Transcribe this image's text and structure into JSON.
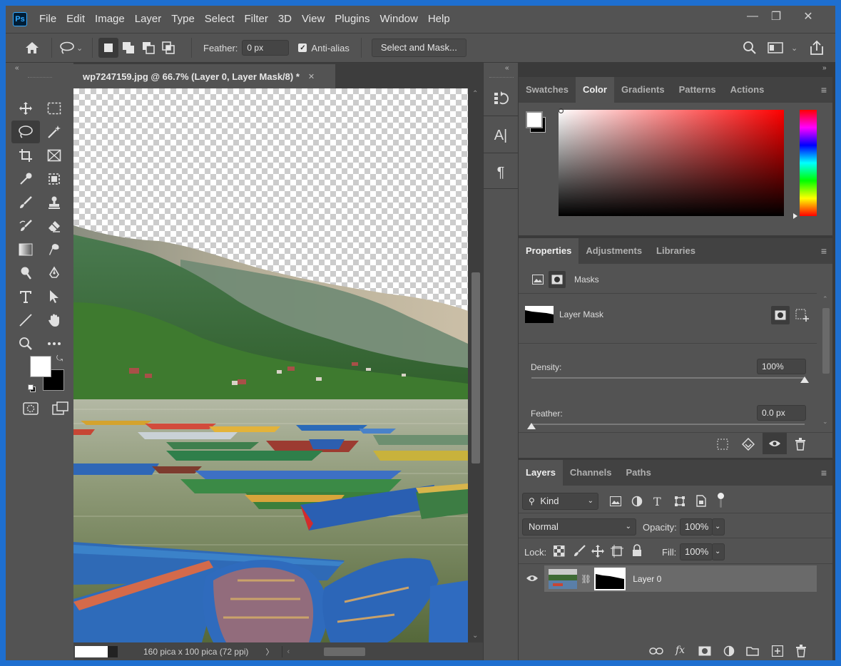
{
  "app": {
    "logo": "Ps"
  },
  "menu": [
    "File",
    "Edit",
    "Image",
    "Layer",
    "Type",
    "Select",
    "Filter",
    "3D",
    "View",
    "Plugins",
    "Window",
    "Help"
  ],
  "window_controls": {
    "minimize": "—",
    "maximize": "❐",
    "close": "✕"
  },
  "options_bar": {
    "feather_label": "Feather:",
    "feather_value": "0 px",
    "antialias_label": "Anti-alias",
    "antialias_checked": true,
    "select_mask_label": "Select and Mask..."
  },
  "document": {
    "tab_title": "wp7247159.jpg @ 66.7% (Layer 0, Layer Mask/8) *",
    "close_glyph": "✕",
    "status_text": "160 pica x 100 pica (72 ppi)",
    "status_arrow": "〉"
  },
  "toolbar": {
    "collapse": "«"
  },
  "mini_dock": {
    "collapse": "«",
    "items": [
      "history-icon",
      "character-icon",
      "paragraph-icon"
    ],
    "char_label": "A|",
    "para_label": "¶"
  },
  "color_panel": {
    "collapse": "»",
    "tabs": [
      "Swatches",
      "Color",
      "Gradients",
      "Patterns",
      "Actions"
    ],
    "active_tab": "Color",
    "menu_glyph": "≡",
    "accent_color": "#ff0000"
  },
  "properties_panel": {
    "tabs": [
      "Properties",
      "Adjustments",
      "Libraries"
    ],
    "active_tab": "Properties",
    "masks_label": "Masks",
    "layer_mask_label": "Layer Mask",
    "density_label": "Density:",
    "density_value": "100%",
    "density_fraction": 1.0,
    "feather_label": "Feather:",
    "feather_value": "0.0 px",
    "feather_fraction": 0.0
  },
  "layers_panel": {
    "tabs": [
      "Layers",
      "Channels",
      "Paths"
    ],
    "active_tab": "Layers",
    "kind_label": "Kind",
    "blend_mode": "Normal",
    "opacity_label": "Opacity:",
    "opacity_value": "100%",
    "lock_label": "Lock:",
    "fill_label": "Fill:",
    "fill_value": "100%",
    "layers": [
      {
        "name": "Layer 0",
        "visible": true
      }
    ],
    "fx_label": "fx"
  }
}
